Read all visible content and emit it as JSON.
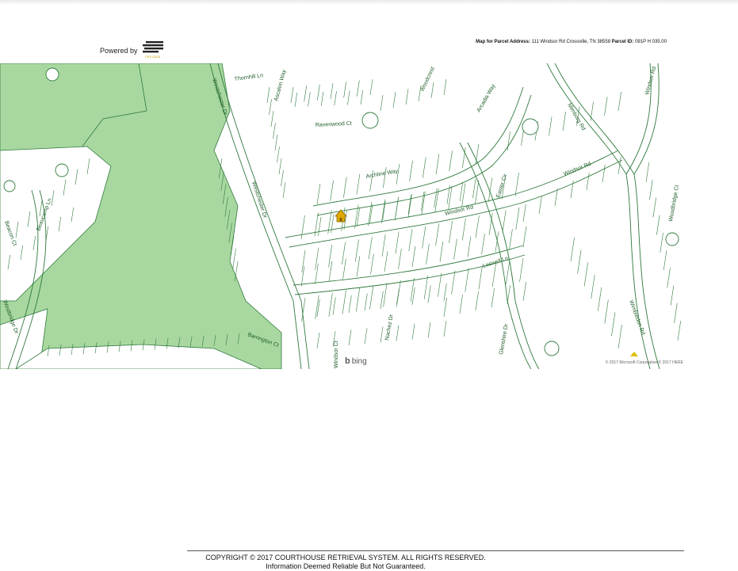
{
  "header": {
    "powered_label": "Powered by",
    "logo_tagline": "CRS DATA",
    "address_label": "Map for Parcel Address:",
    "address_value": "111 Windsor Rd Crossville, TN 38558",
    "parcel_label": "Parcel ID:",
    "parcel_value": "091P H 035.00"
  },
  "map": {
    "streets": [
      {
        "id": "thornhill-ln",
        "label": "Thornhill Ln"
      },
      {
        "id": "ascalon-way",
        "label": "Ascalon Way"
      },
      {
        "id": "westchester-dr",
        "label": "Westchester Dr"
      },
      {
        "id": "westchester-dr-2",
        "label": "Westchester Dr"
      },
      {
        "id": "ravenwood-ct",
        "label": "Ravenwood Ct"
      },
      {
        "id": "archline-way",
        "label": "Archline Way"
      },
      {
        "id": "windsor-rd",
        "label": "Windsor Rd"
      },
      {
        "id": "windsor-rd-2",
        "label": "Windsor Rd"
      },
      {
        "id": "windsor-rd-3",
        "label": "Windsor Rd"
      },
      {
        "id": "leswell-ln",
        "label": "Leswell Ln"
      },
      {
        "id": "easter-cir",
        "label": "Easter Cir"
      },
      {
        "id": "arcadia-way",
        "label": "Arcadia Way"
      },
      {
        "id": "woodcrest",
        "label": "Woodcrest"
      },
      {
        "id": "mimborg-rd",
        "label": "Mimborg Rd"
      },
      {
        "id": "beaucamp-ln",
        "label": "Beaucamp Ln"
      },
      {
        "id": "beacon-ct",
        "label": "Beacon Ct"
      },
      {
        "id": "barrington-ct",
        "label": "Barrington Ct"
      },
      {
        "id": "nachez-dr",
        "label": "Nachez Dr"
      },
      {
        "id": "glenshire-dr",
        "label": "Glenshire Dr"
      },
      {
        "id": "wimbledon-rd",
        "label": "Wimbledon Rd"
      },
      {
        "id": "woodbridge-ct",
        "label": "Woodbridge Ct"
      },
      {
        "id": "windsor-ct",
        "label": "Windsor Ct"
      },
      {
        "id": "westbridge-dr",
        "label": "Westbridge Dr"
      }
    ],
    "bing_label": "bing",
    "copyright": "© 2017 Microsoft Corporation © 2017 HERE",
    "colors": {
      "green_area": "#a8d8a0",
      "parcel_line": "#2f7a3c",
      "marker": "#e0a800"
    },
    "marker_icon": "house-icon"
  },
  "footer": {
    "copyright": "COPYRIGHT © 2017 COURTHOUSE RETRIEVAL SYSTEM. ALL RIGHTS RESERVED.",
    "disclaimer": "Information Deemed Reliable But Not Guaranteed."
  }
}
